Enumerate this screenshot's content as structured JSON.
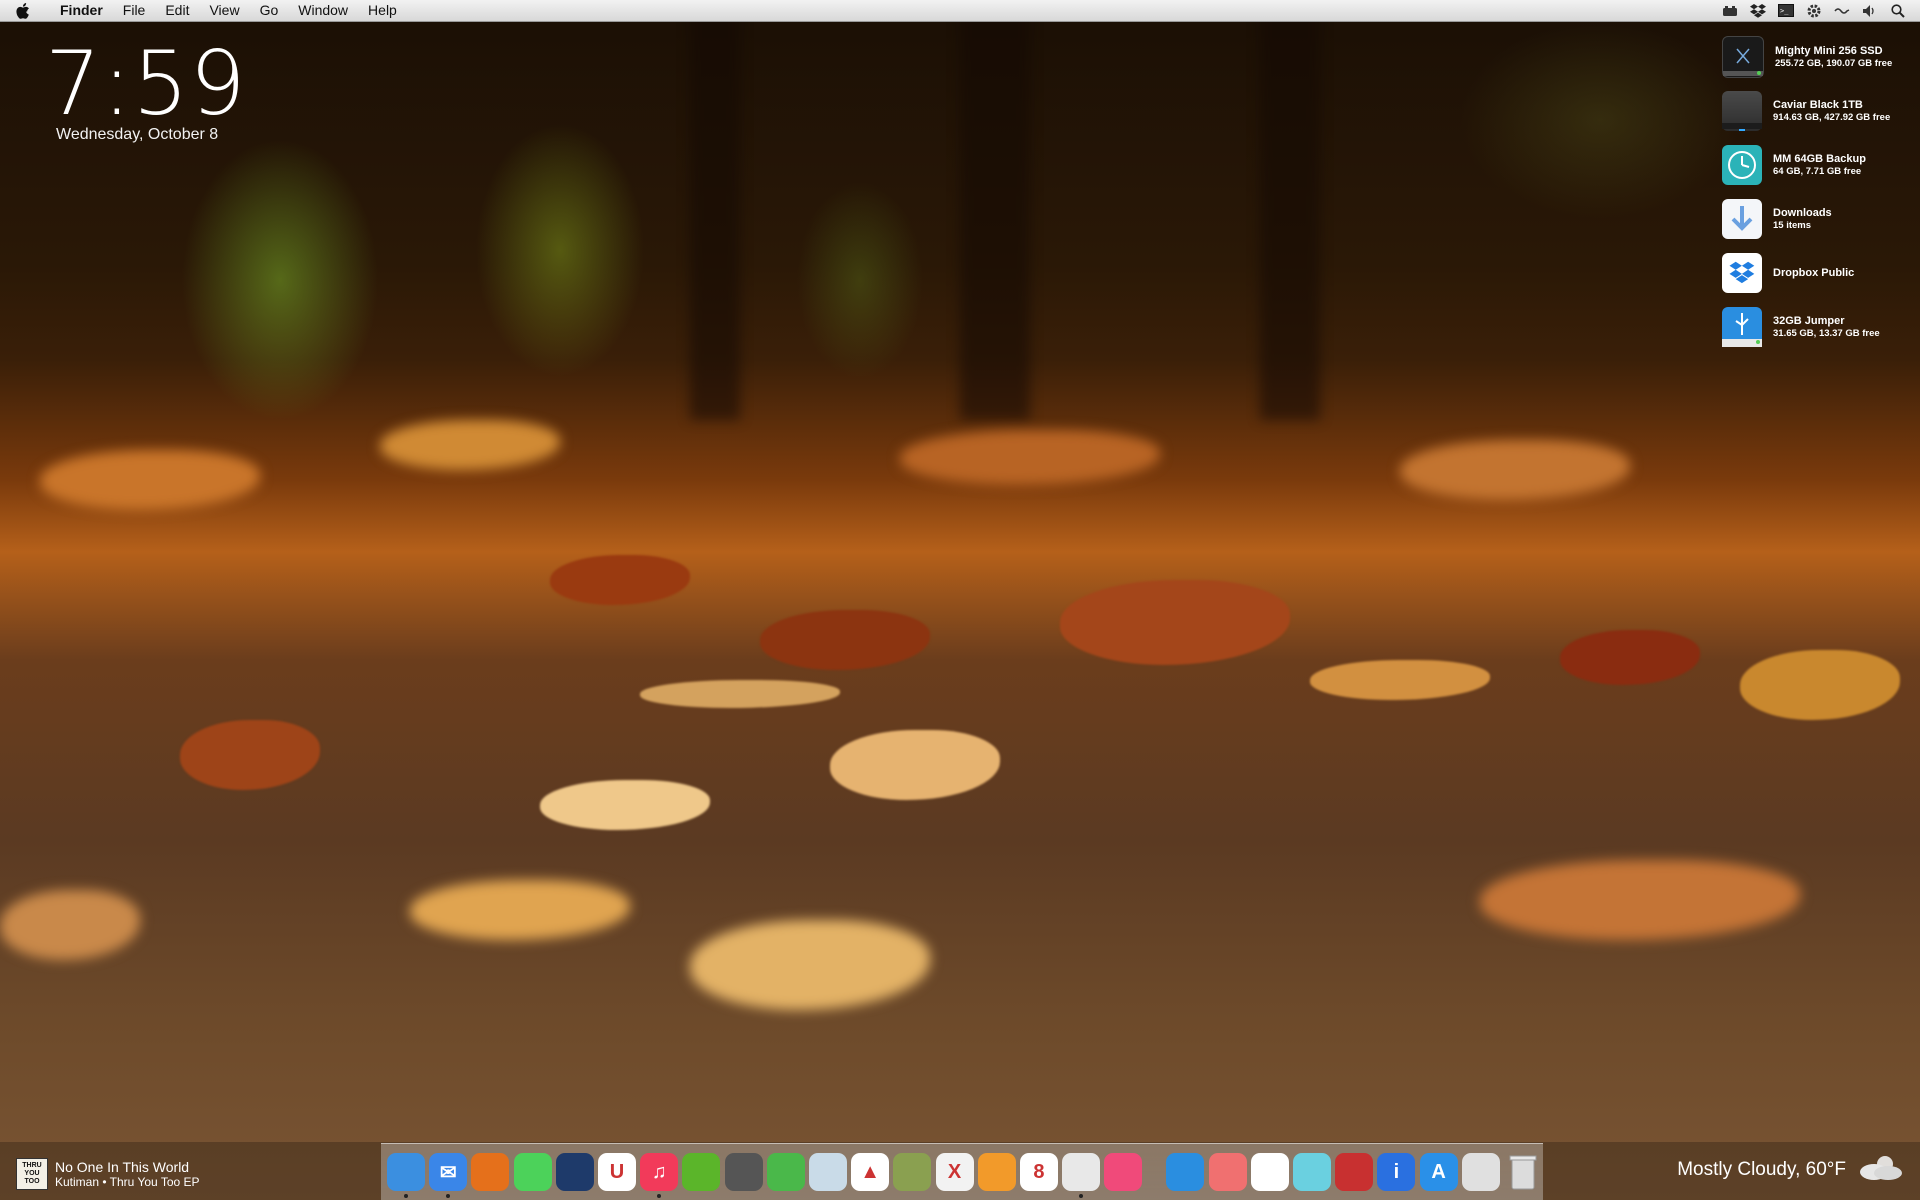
{
  "menubar": {
    "app_name": "Finder",
    "items": [
      "File",
      "Edit",
      "View",
      "Go",
      "Window",
      "Help"
    ],
    "status_icons": [
      "drive-eject-icon",
      "dropbox-icon",
      "terminal-icon",
      "gear-icon",
      "wifi-icon",
      "volume-icon",
      "spotlight-icon"
    ]
  },
  "clock": {
    "time": "7:59",
    "date": "Wednesday, October  8"
  },
  "drives": [
    {
      "name": "Mighty Mini 256 SSD",
      "sub": "255.72 GB, 190.07 GB free",
      "icon": "ssd-drive-icon",
      "color": "#1c1c1c"
    },
    {
      "name": "Caviar Black 1TB",
      "sub": "914.63 GB, 427.92 GB free",
      "icon": "hard-drive-icon",
      "color": "#3a3a3a"
    },
    {
      "name": "MM 64GB Backup",
      "sub": "64 GB, 7.71 GB free",
      "icon": "time-machine-icon",
      "color": "#2bb3b8"
    },
    {
      "name": "Downloads",
      "sub": "15 items",
      "icon": "downloads-folder-icon",
      "color": "#f4f6f9"
    },
    {
      "name": "Dropbox Public",
      "sub": "",
      "icon": "dropbox-folder-icon",
      "color": "#ffffff"
    },
    {
      "name": "32GB Jumper",
      "sub": "31.65 GB, 13.37 GB free",
      "icon": "usb-drive-icon",
      "color": "#2a8ee0"
    }
  ],
  "now_playing": {
    "art_text": [
      "THRU",
      "YOU",
      "TOO"
    ],
    "title": "No One In This World",
    "artist": "Kutiman • Thru You Too EP"
  },
  "weather": {
    "text": "Mostly Cloudy, 60°F"
  },
  "dock": {
    "apps": [
      {
        "name": "finder",
        "color": "#3b8fe0",
        "running": true,
        "glyph": ""
      },
      {
        "name": "mail",
        "color": "#3a86e8",
        "running": true,
        "glyph": "✉"
      },
      {
        "name": "firefox",
        "color": "#e5701b",
        "running": false,
        "glyph": ""
      },
      {
        "name": "messages",
        "color": "#4cd25a",
        "running": false,
        "glyph": ""
      },
      {
        "name": "caffeine",
        "color": "#1e3a6a",
        "running": false,
        "glyph": ""
      },
      {
        "name": "magnet",
        "color": "#ffffff",
        "running": false,
        "glyph": "U"
      },
      {
        "name": "itunes",
        "color": "#f23a5a",
        "running": true,
        "glyph": "♫"
      },
      {
        "name": "spotify",
        "color": "#5bb52a",
        "running": false,
        "glyph": ""
      },
      {
        "name": "dvd-player",
        "color": "#555555",
        "running": false,
        "glyph": ""
      },
      {
        "name": "searchlight",
        "color": "#4ab84a",
        "running": false,
        "glyph": ""
      },
      {
        "name": "preview",
        "color": "#c9dbe8",
        "running": false,
        "glyph": ""
      },
      {
        "name": "vlc",
        "color": "#ffffff",
        "running": false,
        "glyph": "▲"
      },
      {
        "name": "reeder",
        "color": "#8aa050",
        "running": false,
        "glyph": ""
      },
      {
        "name": "crossover",
        "color": "#f2f2f2",
        "running": false,
        "glyph": "X"
      },
      {
        "name": "pages",
        "color": "#f29a2a",
        "running": false,
        "glyph": ""
      },
      {
        "name": "calendar",
        "color": "#ffffff",
        "running": false,
        "glyph": "8"
      },
      {
        "name": "screenshot",
        "color": "#e8e8e8",
        "running": true,
        "glyph": ""
      },
      {
        "name": "skitch",
        "color": "#f04a7a",
        "running": false,
        "glyph": ""
      }
    ],
    "apps2": [
      {
        "name": "headphones",
        "color": "#2a8ee0",
        "running": false,
        "glyph": ""
      },
      {
        "name": "radio",
        "color": "#f07070",
        "running": false,
        "glyph": ""
      },
      {
        "name": "photos",
        "color": "#ffffff",
        "running": false,
        "glyph": ""
      },
      {
        "name": "final-cut",
        "color": "#6ad0e0",
        "running": false,
        "glyph": ""
      },
      {
        "name": "lego",
        "color": "#c83030",
        "running": false,
        "glyph": ""
      },
      {
        "name": "info",
        "color": "#2a70e0",
        "running": false,
        "glyph": "i"
      },
      {
        "name": "app-store",
        "color": "#2a90e8",
        "running": false,
        "glyph": "A"
      },
      {
        "name": "display",
        "color": "#e0e0e0",
        "running": false,
        "glyph": ""
      },
      {
        "name": "trash",
        "color": "transparent",
        "running": false,
        "glyph": ""
      }
    ]
  }
}
